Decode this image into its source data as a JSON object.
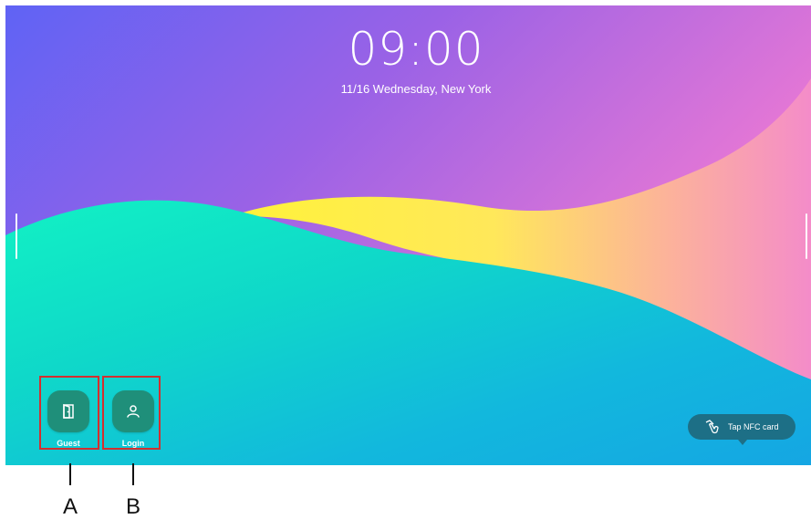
{
  "lock_screen": {
    "time": "09:00",
    "date_location": "11/16 Wednesday, New York"
  },
  "apps": [
    {
      "label": "Guest",
      "icon": "door-icon"
    },
    {
      "label": "Login",
      "icon": "user-icon"
    }
  ],
  "nfc": {
    "label": "Tap NFC card",
    "icon": "nfc-tap-icon"
  },
  "callouts": [
    {
      "letter": "A",
      "target": "Guest"
    },
    {
      "letter": "B",
      "target": "Login"
    }
  ],
  "colors": {
    "tile": "#1f8f7a",
    "nfc_pill": "#1d6f86",
    "callout_box": "#d32f2f"
  }
}
